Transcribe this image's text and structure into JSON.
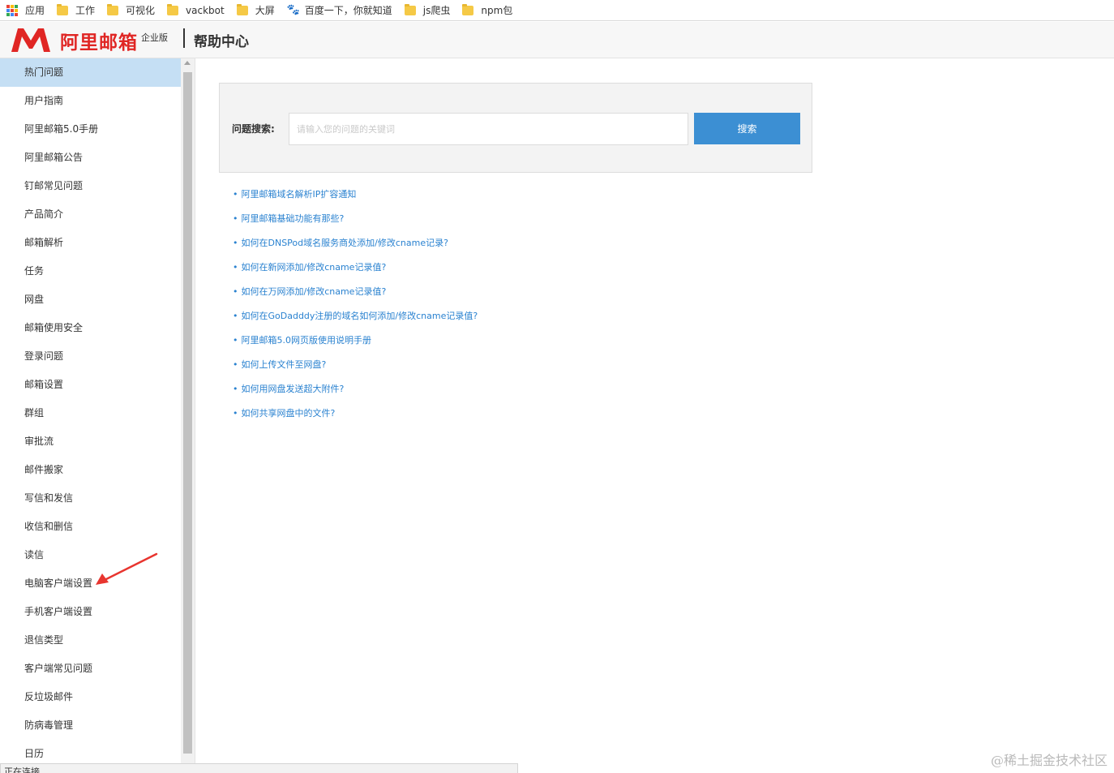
{
  "bookmarks": [
    {
      "label": "应用",
      "icon": "apps-grid-icon"
    },
    {
      "label": "工作",
      "icon": "folder-icon"
    },
    {
      "label": "可视化",
      "icon": "folder-icon"
    },
    {
      "label": "vackbot",
      "icon": "folder-icon"
    },
    {
      "label": "大屏",
      "icon": "folder-icon"
    },
    {
      "label": "百度一下，你就知道",
      "icon": "baidu-paw-icon"
    },
    {
      "label": "js爬虫",
      "icon": "folder-icon"
    },
    {
      "label": "npm包",
      "icon": "folder-icon"
    }
  ],
  "header": {
    "logo_text": "阿里邮箱",
    "edition": "企业版",
    "title": "帮助中心",
    "brand_color": "#e02624"
  },
  "sidebar": {
    "active_index": 0,
    "items": [
      "热门问题",
      "用户指南",
      "阿里邮箱5.0手册",
      "阿里邮箱公告",
      "钉邮常见问题",
      "产品简介",
      "邮箱解析",
      "任务",
      "网盘",
      "邮箱使用安全",
      "登录问题",
      "邮箱设置",
      "群组",
      "审批流",
      "邮件搬家",
      "写信和发信",
      "收信和删信",
      "读信",
      "电脑客户端设置",
      "手机客户端设置",
      "退信类型",
      "客户端常见问题",
      "反垃圾邮件",
      "防病毒管理",
      "日历"
    ]
  },
  "search": {
    "label": "问题搜索:",
    "placeholder": "请输入您的问题的关键词",
    "value": "",
    "button": "搜索",
    "button_color": "#3c8fd3"
  },
  "links": {
    "bullet": "•",
    "items": [
      "阿里邮箱域名解析IP扩容通知",
      "阿里邮箱基础功能有那些?",
      "如何在DNSPod域名服务商处添加/修改cname记录?",
      "如何在新网添加/修改cname记录值?",
      "如何在万网添加/修改cname记录值?",
      "如何在GoDadddy注册的域名如何添加/修改cname记录值?",
      "阿里邮箱5.0网页版使用说明手册",
      "如何上传文件至网盘?",
      "如何用网盘发送超大附件?",
      "如何共享网盘中的文件?"
    ]
  },
  "status": {
    "text": "正在连接..."
  },
  "watermark": "@稀土掘金技术社区"
}
